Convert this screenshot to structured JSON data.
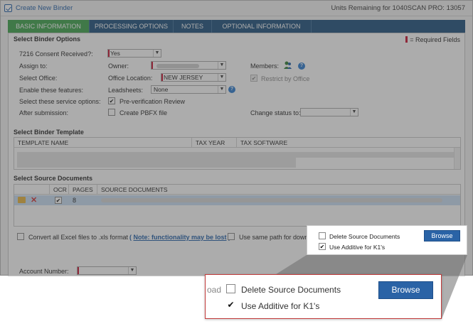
{
  "window": {
    "title": "Create New Binder",
    "units_remaining": "Units Remaining for 1040SCAN PRO: 13057"
  },
  "tabs": [
    {
      "label": "BASIC INFORMATION",
      "active": true
    },
    {
      "label": "PROCESSING OPTIONS",
      "active": false
    },
    {
      "label": "NOTES",
      "active": false
    },
    {
      "label": "OPTIONAL INFORMATION",
      "active": false
    }
  ],
  "binder_options": {
    "section_title": "Select Binder Options",
    "required_note": "= Required Fields",
    "consent_label": "7216 Consent Received?:",
    "consent_value": "Yes",
    "assign_label": "Assign to:",
    "owner_label": "Owner:",
    "members_label": "Members:",
    "office_label": "Select Office:",
    "office_location_label": "Office Location:",
    "office_location_value": "NEW JERSEY",
    "restrict_label": "Restrict by Office",
    "features_label": "Enable these features:",
    "leadsheets_label": "Leadsheets:",
    "leadsheets_value": "None",
    "service_label": "Select these service options:",
    "preverification_label": "Pre-verification Review",
    "after_label": "After submission:",
    "pbfx_label": "Create PBFX file",
    "change_status_label": "Change status to:"
  },
  "template": {
    "section_title": "Select Binder Template",
    "columns": [
      "TEMPLATE NAME",
      "TAX YEAR",
      "TAX SOFTWARE"
    ]
  },
  "source_docs": {
    "section_title": "Select Source Documents",
    "columns": [
      "OCR",
      "PAGES",
      "SOURCE DOCUMENTS"
    ],
    "rows": [
      {
        "ocr": "✔",
        "pages": "8"
      }
    ]
  },
  "bottom_options": {
    "convert_label": "Convert all Excel files to .xls format",
    "note_label": "Note: functionality may be lost",
    "same_path_label": "Use same path for download",
    "account_label": "Account Number:"
  },
  "zoom_panel": {
    "partial_label": "oad",
    "delete_label": "Delete Source Documents",
    "additive_label": "Use Additive for K1's",
    "browse_label": "Browse"
  },
  "colors": {
    "tab_bar": "#1d4f7c",
    "active_tab": "#3ba24a",
    "browse_button": "#2a63a6",
    "required_mark": "#c8102e",
    "callout_border": "#c23a3a"
  }
}
